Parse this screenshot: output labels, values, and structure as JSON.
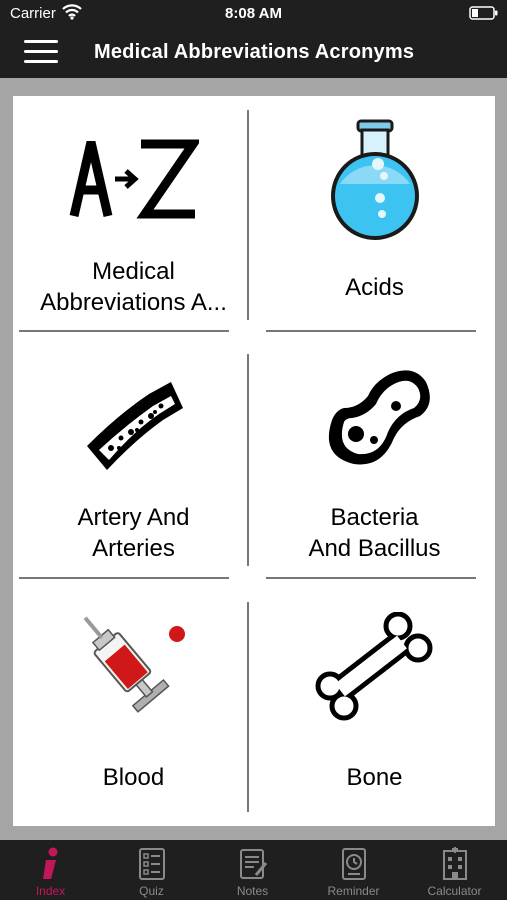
{
  "status": {
    "carrier": "Carrier",
    "time": "8:08 AM"
  },
  "header": {
    "title": "Medical Abbreviations Acronyms"
  },
  "tiles": [
    {
      "label": "Medical\nAbbreviations A...",
      "icon": "a-to-z-icon"
    },
    {
      "label": "Acids",
      "icon": "flask-icon"
    },
    {
      "label": "Artery And\nArteries",
      "icon": "artery-icon"
    },
    {
      "label": "Bacteria\nAnd Bacillus",
      "icon": "bacteria-icon"
    },
    {
      "label": "Blood",
      "icon": "syringe-icon"
    },
    {
      "label": "Bone",
      "icon": "bone-icon"
    }
  ],
  "tabs": [
    {
      "label": "Index",
      "icon": "info-icon",
      "active": true
    },
    {
      "label": "Quiz",
      "icon": "quiz-icon",
      "active": false
    },
    {
      "label": "Notes",
      "icon": "notes-icon",
      "active": false
    },
    {
      "label": "Reminder",
      "icon": "reminder-icon",
      "active": false
    },
    {
      "label": "Calculator",
      "icon": "calculator-icon",
      "active": false
    }
  ],
  "colors": {
    "bar": "#1f1f1f",
    "background": "#a5a5a5",
    "active_tab": "#c2185b",
    "tab_inactive": "#8a8a8a"
  }
}
